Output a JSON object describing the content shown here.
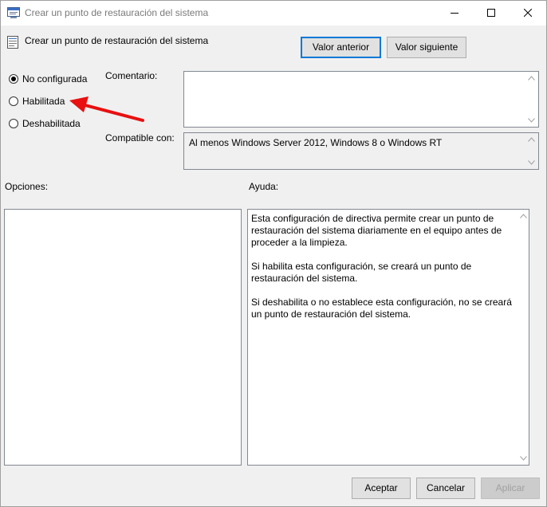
{
  "window": {
    "title": "Crear un punto de restauración del sistema",
    "header_title": "Crear un punto de restauración del sistema"
  },
  "nav": {
    "previous_label": "Valor anterior",
    "next_label": "Valor siguiente"
  },
  "state": {
    "options": [
      {
        "label": "No configurada",
        "selected": true
      },
      {
        "label": "Habilitada",
        "selected": false
      },
      {
        "label": "Deshabilitada",
        "selected": false
      }
    ]
  },
  "comment": {
    "label": "Comentario:",
    "value": ""
  },
  "supported": {
    "label": "Compatible con:",
    "value": "Al menos Windows Server 2012, Windows 8 o Windows RT"
  },
  "options_panel": {
    "label": "Opciones:"
  },
  "help_panel": {
    "label": "Ayuda:",
    "paragraphs": [
      "Esta configuración de directiva permite crear un punto de restauración del sistema diariamente en el equipo antes de proceder a la limpieza.",
      "Si habilita esta configuración, se creará un punto de restauración del sistema.",
      "Si deshabilita o no establece esta configuración, no se creará un punto de restauración del sistema."
    ]
  },
  "footer": {
    "accept_label": "Aceptar",
    "cancel_label": "Cancelar",
    "apply_label": "Aplicar"
  },
  "colors": {
    "focus_border": "#0078d7",
    "annotation_arrow": "#e81010",
    "window_bg": "#f0f0f0"
  },
  "icons": [
    "policy-window-icon",
    "policy-header-icon",
    "minimize-icon",
    "maximize-icon",
    "close-icon",
    "annotation-arrow-icon"
  ]
}
